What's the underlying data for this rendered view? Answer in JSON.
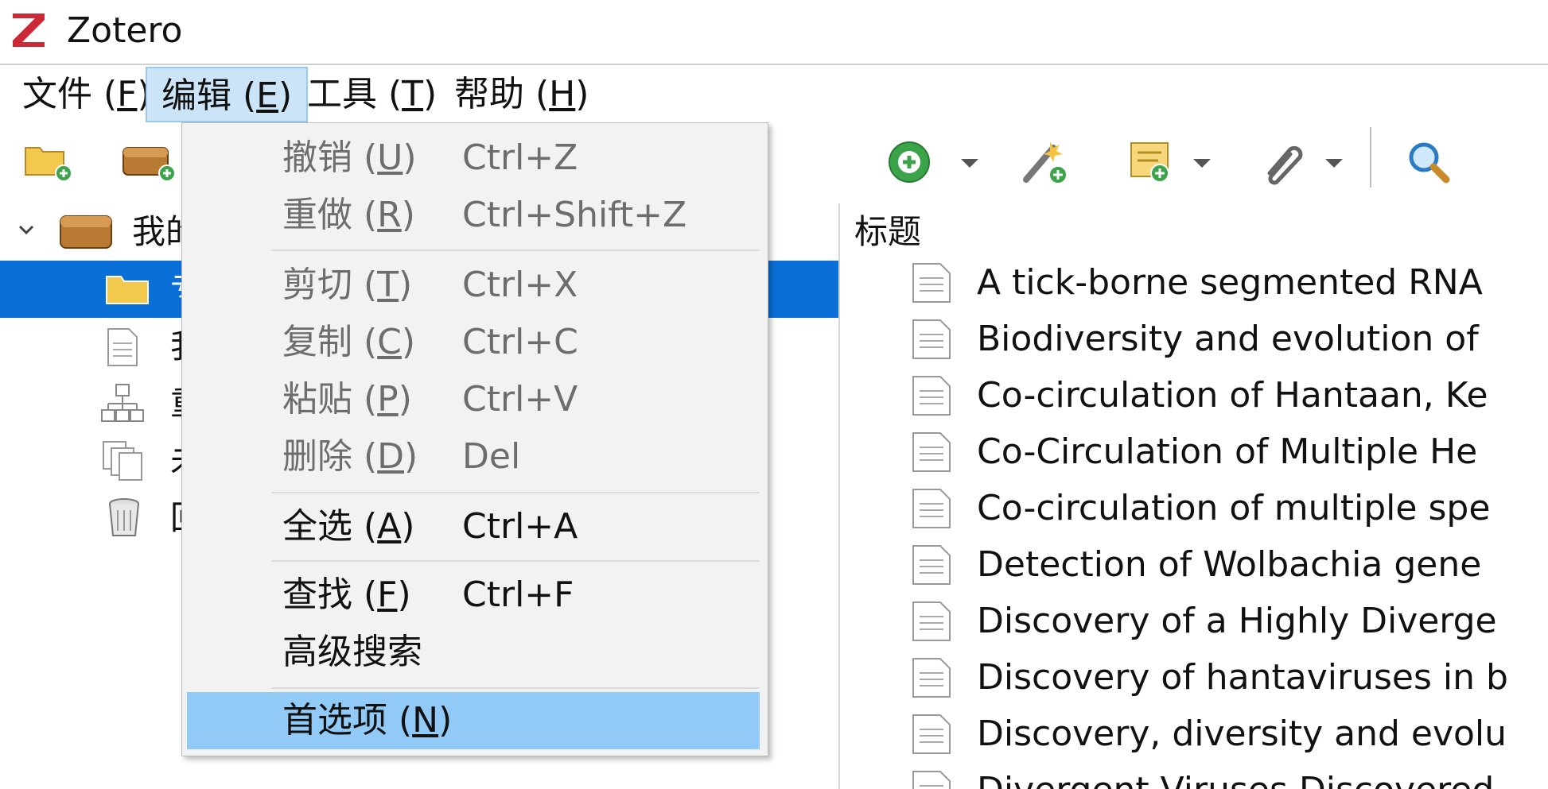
{
  "window": {
    "title": "Zotero",
    "logo_letter": "Z",
    "logo_color": "#cc2936"
  },
  "menubar": [
    {
      "label": "文件",
      "mnemonic": "F"
    },
    {
      "label": "编辑",
      "mnemonic": "E",
      "active": true
    },
    {
      "label": "工具",
      "mnemonic": "T"
    },
    {
      "label": "帮助",
      "mnemonic": "H"
    }
  ],
  "edit_menu": {
    "undo": {
      "label": "撤销",
      "mnemonic": "U",
      "shortcut": "Ctrl+Z",
      "enabled": false
    },
    "redo": {
      "label": "重做",
      "mnemonic": "R",
      "shortcut": "Ctrl+Shift+Z",
      "enabled": false
    },
    "cut": {
      "label": "剪切",
      "mnemonic": "T",
      "shortcut": "Ctrl+X",
      "enabled": false
    },
    "copy": {
      "label": "复制",
      "mnemonic": "C",
      "shortcut": "Ctrl+C",
      "enabled": false
    },
    "paste": {
      "label": "粘贴",
      "mnemonic": "P",
      "shortcut": "Ctrl+V",
      "enabled": false
    },
    "delete": {
      "label": "删除",
      "mnemonic": "D",
      "shortcut": "Del",
      "enabled": false
    },
    "select_all": {
      "label": "全选",
      "mnemonic": "A",
      "shortcut": "Ctrl+A",
      "enabled": true
    },
    "find": {
      "label": "查找",
      "mnemonic": "F",
      "shortcut": "Ctrl+F",
      "enabled": true
    },
    "advanced_search": {
      "label": "高级搜索",
      "enabled": true
    },
    "preferences": {
      "label": "首选项",
      "mnemonic": "N",
      "enabled": true,
      "highlighted": true
    }
  },
  "toolbar": {
    "left_icons": [
      "new-collection-icon",
      "new-library-icon"
    ],
    "right_icons": [
      "new-item-icon",
      "add-by-identifier-icon",
      "new-note-icon",
      "attachment-icon",
      "search-icon"
    ]
  },
  "collections": {
    "root_label_visible": "我的",
    "visible_fragments": [
      "专",
      "我",
      "重",
      "未",
      "回"
    ],
    "selected_index": 0
  },
  "items": {
    "column_header": "标题",
    "rows": [
      "A tick-borne segmented RNA",
      "Biodiversity and evolution of",
      "Co-circulation of Hantaan, Ke",
      "Co-Circulation of Multiple He",
      "Co-circulation of multiple spe",
      "Detection of Wolbachia gene",
      "Discovery of a Highly Diverge",
      "Discovery of hantaviruses in b",
      "Discovery, diversity and evolu",
      "Divergent Viruses Discovered"
    ]
  },
  "colors": {
    "selection": "#0a6fd6",
    "menu_highlight": "#91c9f7",
    "menu_active": "#cce4f7"
  }
}
